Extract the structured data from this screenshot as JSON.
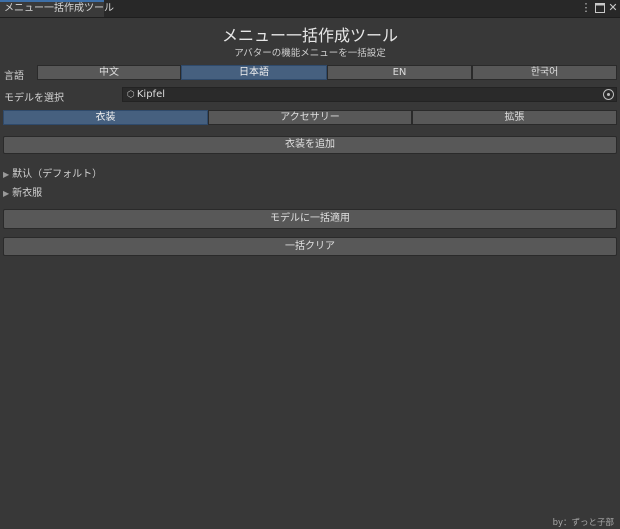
{
  "window": {
    "tab_title": "メニュー一括作成ツール",
    "menu_icon": "kebab-menu-icon",
    "maximize_icon": "maximize-icon",
    "close_icon": "close-icon"
  },
  "header": {
    "title": "メニュー一括作成ツール",
    "subtitle": "アバターの機能メニューを一括設定"
  },
  "language": {
    "label": "言語",
    "options": [
      "中文",
      "日本語",
      "EN",
      "한국어"
    ],
    "selected": "日本語"
  },
  "model": {
    "label": "モデルを選択",
    "value": "Kipfel",
    "value_icon": "gameobject-cube-icon",
    "picker_icon": "object-picker-icon"
  },
  "tabs": {
    "items": [
      "衣装",
      "アクセサリー",
      "拡張"
    ],
    "selected": "衣装"
  },
  "actions": {
    "add_outfit": "衣装を追加",
    "apply_all": "モデルに一括適用",
    "clear_all": "一括クリア"
  },
  "outfits": [
    {
      "label": "默认（デフォルト）",
      "expanded": false
    },
    {
      "label": "新衣服",
      "expanded": false
    }
  ],
  "footer": {
    "credit": "by：ずっと子部"
  },
  "colors": {
    "background": "#383838",
    "active_accent": "#46607f",
    "button": "#585858"
  }
}
